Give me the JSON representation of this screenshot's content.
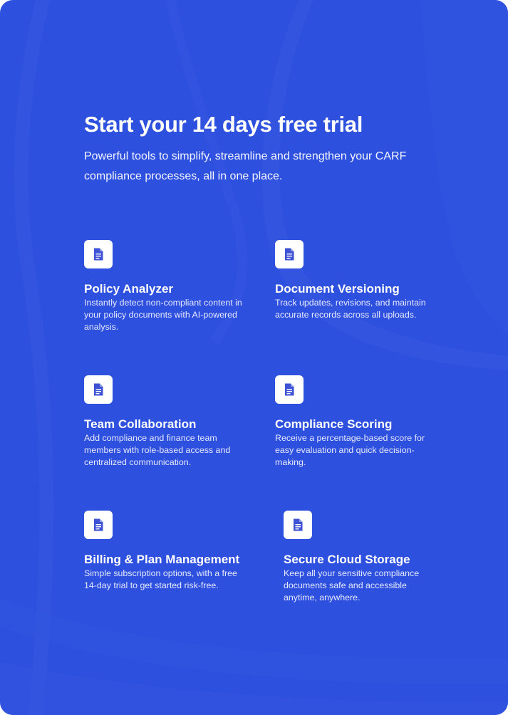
{
  "page": {
    "title": "Start your 14 days free trial",
    "subtitle": "Powerful tools to simplify, streamline and strengthen your CARF compliance processes, all in one place."
  },
  "colors": {
    "background": "#2e50de",
    "card": "#ffffff",
    "icon": "#3d52d5"
  },
  "features": [
    {
      "icon": "document-icon",
      "title": "Policy Analyzer",
      "description": "Instantly detect non-compliant content in your policy documents with AI-powered analysis."
    },
    {
      "icon": "document-icon",
      "title": "Document Versioning",
      "description": "Track updates, revisions, and maintain accurate records across all uploads."
    },
    {
      "icon": "document-icon",
      "title": "Team Collaboration",
      "description": "Add compliance and finance team members with role-based access and centralized communication."
    },
    {
      "icon": "document-icon",
      "title": "Compliance Scoring",
      "description": "Receive a percentage-based score for easy evaluation and quick decision-making."
    },
    {
      "icon": "document-icon",
      "title": "Billing & Plan Management",
      "description": "Simple subscription options, with a free 14-day trial to get started risk-free."
    },
    {
      "icon": "document-icon",
      "title": "Secure Cloud Storage",
      "description": "Keep all your sensitive compliance documents safe and accessible anytime, anywhere."
    }
  ]
}
